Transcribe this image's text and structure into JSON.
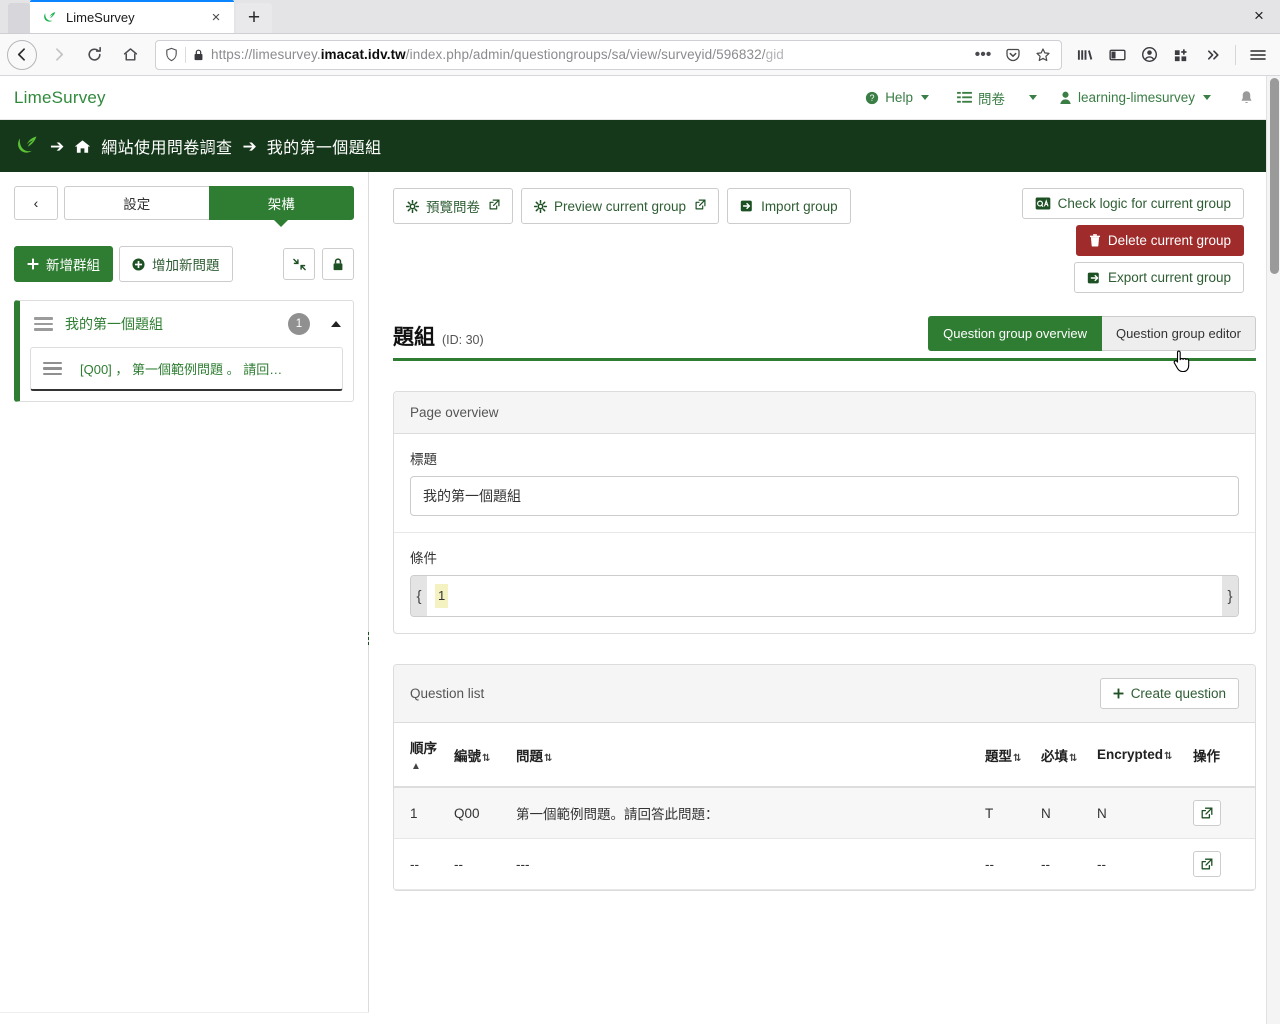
{
  "browser": {
    "tab": {
      "title": "LimeSurvey",
      "favicon": "limesurvey-icon",
      "close_label": "×"
    },
    "newtab_label": "+",
    "window_close_label": "×",
    "nav": {
      "back_label": "←",
      "forward_label": "→",
      "reload_label": "⟳",
      "home_label": "⌂"
    },
    "url": {
      "prefix": "https://limesurvey.",
      "domain": "imacat.idv.tw",
      "path": "/index.php/admin/questiongroups/sa/view/surveyid/596832/",
      "tail": "gid",
      "shield_icon": "shield-icon",
      "lock_icon": "padlock-icon",
      "page_actions_label": "•••",
      "pocket_icon": "pocket-icon",
      "bookmark_icon": "star-icon"
    },
    "toolbar_icons": [
      "library-icon",
      "sidebar-icon",
      "account-icon",
      "extensions-icon",
      "overflow-icon",
      "menu-icon"
    ]
  },
  "app_header": {
    "brand": "LimeSurvey",
    "help": "Help",
    "surveys": "問卷",
    "user": "learning-limesurvey",
    "bell_icon": "bell-icon"
  },
  "breadcrumb": {
    "logo_icon": "limesurvey-logo-icon",
    "arrow": "➔",
    "home_icon": "home-icon",
    "survey": "網站使用問卷調查",
    "group": "我的第一個題組"
  },
  "sidebar": {
    "back_label": "‹",
    "tab_settings": "設定",
    "tab_structure": "架構",
    "add_group": "新增群組",
    "add_question": "增加新問題",
    "collapse_icon": "collapse-arrows-icon",
    "lock_icon": "lock-icon",
    "group": {
      "title": "我的第一個題組",
      "count": "1",
      "question": "[Q00] ， 第一個範例問題 。 請回…"
    }
  },
  "toolbar": {
    "preview_survey": "預覽問卷",
    "preview_group": "Preview current group",
    "import_group": "Import group",
    "check_logic": "Check logic for current group",
    "delete_group": "Delete current group",
    "export_group": "Export current group",
    "external_icon": "external-link-icon",
    "gear_icon": "gear-icon",
    "import_icon": "import-icon",
    "logic_icon": "logic-check-icon",
    "trash_icon": "trash-icon",
    "export_icon": "export-icon"
  },
  "page": {
    "title": "題組",
    "id_label": "(ID: 30)",
    "tab_overview": "Question group overview",
    "tab_editor": "Question group editor",
    "active_tab": "Question group overview"
  },
  "page_overview": {
    "panel_title": "Page overview",
    "title_label": "標題",
    "title_value": "我的第一個題組",
    "condition_label": "條件",
    "brace_open": "{",
    "brace_close": "}",
    "condition_token": "1"
  },
  "question_list": {
    "panel_title": "Question list",
    "create_button": "Create question",
    "columns": [
      {
        "label": "順序",
        "sort": "▲"
      },
      {
        "label": "編號",
        "sort": "⇅"
      },
      {
        "label": "問題",
        "sort": "⇅"
      },
      {
        "label": "題型",
        "sort": "⇅"
      },
      {
        "label": "必填",
        "sort": "⇅"
      },
      {
        "label": "Encrypted",
        "sort": "⇅"
      },
      {
        "label": "操作",
        "sort": ""
      }
    ],
    "rows": [
      {
        "order": "1",
        "code": "Q00",
        "question": "第一個範例問題。請回答此問題：",
        "type": "T",
        "mandatory": "N",
        "encrypted": "N",
        "action_icon": "external-link-icon"
      },
      {
        "order": "--",
        "code": "--",
        "question": "---",
        "type": "--",
        "mandatory": "--",
        "encrypted": "--",
        "action_icon": "external-link-icon"
      }
    ]
  },
  "colors": {
    "brand_green": "#2e7d32",
    "dark_green": "#16381a",
    "danger_red": "#a02b2b",
    "link_green": "#3a7d45",
    "highlight_yellow": "#f4f2c0"
  }
}
